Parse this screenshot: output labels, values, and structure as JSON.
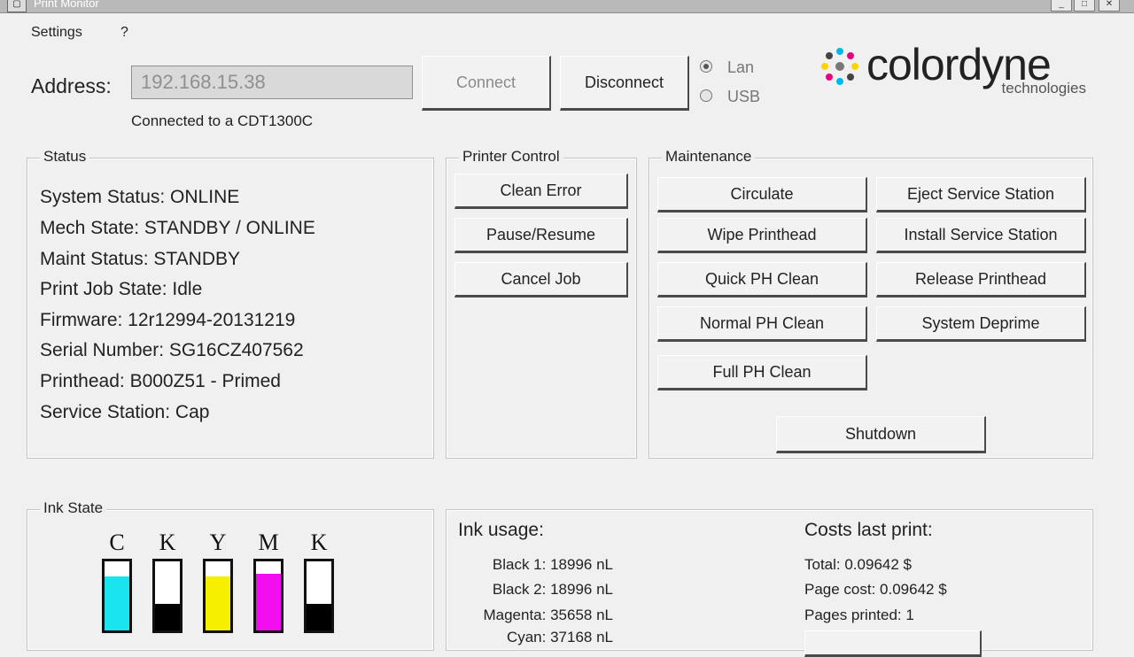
{
  "window": {
    "title": "Print Monitor",
    "icon_glyph": "▢"
  },
  "window_controls": {
    "minimize": "_",
    "maximize": "□",
    "close": "✕"
  },
  "menu": {
    "settings": "Settings",
    "help": "?"
  },
  "connection": {
    "address_label": "Address:",
    "address_value": "192.168.15.38",
    "connect_label": "Connect",
    "disconnect_label": "Disconnect",
    "status_text": "Connected to a CDT1300C",
    "lan_label": "Lan",
    "usb_label": "USB",
    "selected": "Lan"
  },
  "logo": {
    "word": "colordyne",
    "subtitle": "technologies"
  },
  "status": {
    "title": "Status",
    "lines": [
      "System Status: ONLINE",
      "Mech State: STANDBY / ONLINE",
      "Maint Status: STANDBY",
      "Print Job State: Idle",
      "Firmware: 12r12994-20131219",
      "Serial Number: SG16CZ407562",
      "Printhead: B000Z51 -  Primed",
      "Service Station: Cap"
    ]
  },
  "printer_control": {
    "title": "Printer Control",
    "buttons": [
      "Clean Error",
      "Pause/Resume",
      "Cancel Job"
    ]
  },
  "maintenance": {
    "title": "Maintenance",
    "left_buttons": [
      "Circulate",
      "Wipe Printhead",
      "Quick PH Clean",
      "Normal PH Clean",
      "Full PH Clean"
    ],
    "right_buttons": [
      "Eject Service Station",
      "Install Service Station",
      "Release Printhead",
      "System Deprime"
    ],
    "shutdown": "Shutdown"
  },
  "ink_state": {
    "title": "Ink State",
    "inks": [
      {
        "letter": "C",
        "color": "#19e3ec",
        "level": 0.78
      },
      {
        "letter": "K",
        "color": "#000000",
        "level": 0.38
      },
      {
        "letter": "Y",
        "color": "#f6f000",
        "level": 0.78
      },
      {
        "letter": "M",
        "color": "#f20ef0",
        "level": 0.82
      },
      {
        "letter": "K",
        "color": "#000000",
        "level": 0.38
      }
    ]
  },
  "ink_usage": {
    "title": "Ink usage:",
    "lines": [
      "Black 1: 18996 nL",
      "Black 2: 18996 nL",
      "Magenta: 35658 nL",
      "Cyan: 37168 nL"
    ]
  },
  "costs": {
    "title": "Costs last print:",
    "lines": [
      "Total: 0.09642 $",
      "Page cost: 0.09642 $",
      "Pages printed: 1"
    ]
  }
}
